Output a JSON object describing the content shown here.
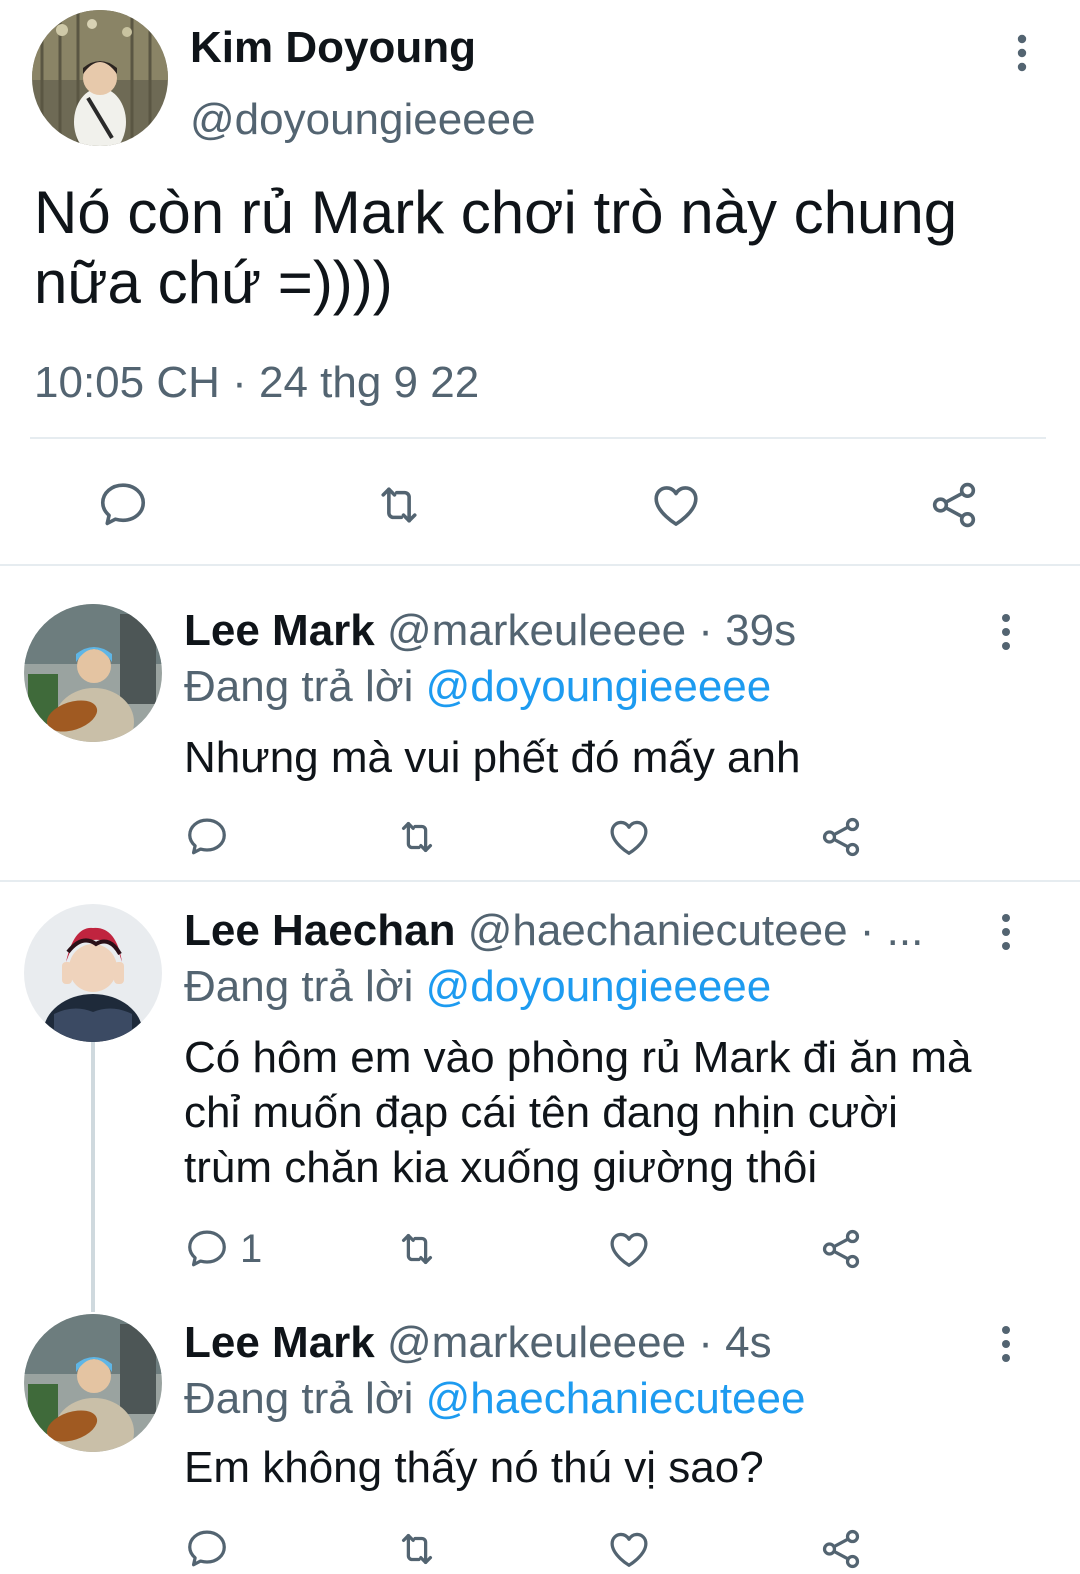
{
  "main_tweet": {
    "author_name": "Kim Doyoung",
    "handle": "@doyoungieeeee",
    "text": "Nó còn rủ Mark chơi trò này chung nữa chứ =))))",
    "timestamp": "10:05 CH · 24 thg 9 22",
    "actions": [
      "reply-icon",
      "retweet-icon",
      "like-icon",
      "share-icon"
    ]
  },
  "replies": [
    {
      "author_name": "Lee Mark",
      "handle_time": "@markeuleeee · 39s",
      "replying_prefix": "Đang trả lời",
      "replying_to": "@doyoungieeeee",
      "text": "Nhưng mà vui phết đó mấy anh",
      "reply_count": ""
    },
    {
      "author_name": "Lee Haechan",
      "handle_time": "@haechaniecuteee · ...",
      "replying_prefix": "Đang trả lời",
      "replying_to": "@doyoungieeeee",
      "text": "Có hôm em vào phòng rủ Mark đi ăn mà chỉ muốn đạp cái tên đang nhịn cười trùm chăn kia xuống giường thôi",
      "reply_count": "1"
    },
    {
      "author_name": "Lee Mark",
      "handle_time": "@markeuleeee · 4s",
      "replying_prefix": "Đang trả lời",
      "replying_to": "@haechaniecuteee",
      "text": "Em không thấy nó thú vị sao?",
      "reply_count": ""
    }
  ],
  "colors": {
    "text": "#0f1419",
    "secondary": "#536471",
    "mention": "#1d9bf0",
    "divider": "#e6ecf0"
  }
}
